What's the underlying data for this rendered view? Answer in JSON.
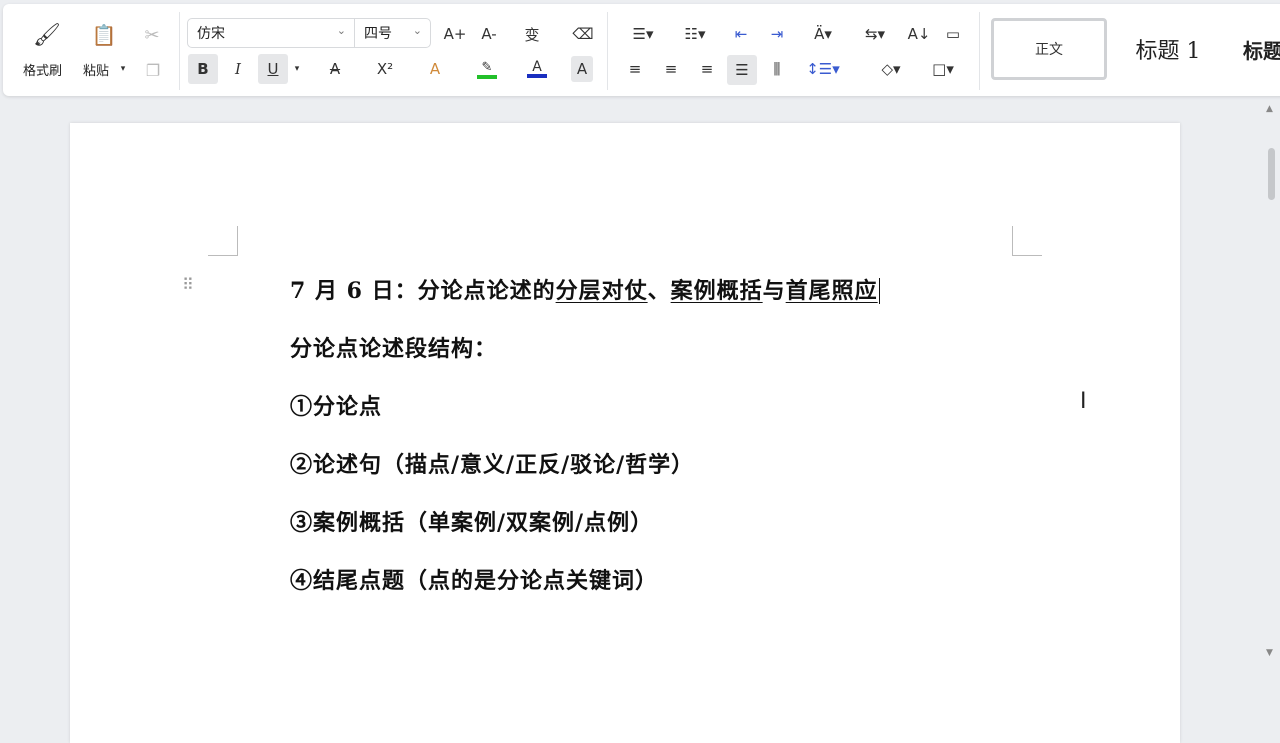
{
  "ribbon": {
    "clipboard": {
      "format_painter": "格式刷",
      "paste": "粘贴"
    },
    "font": {
      "family": "仿宋",
      "size": "四号",
      "grow": "A+",
      "shrink": "A-",
      "phonetic": "变",
      "bold": "B",
      "italic": "I",
      "underline": "U",
      "strike": "A",
      "superscript": "X²",
      "effects": "A",
      "highlight_color": "#22c02a",
      "font_color_label": "A",
      "font_color": "#1a2fc0",
      "shading": "A"
    },
    "styles": {
      "normal": "正文",
      "heading1": "标题 1",
      "heading2": "标题"
    }
  },
  "document": {
    "title_prefix": "7 月 6 日：分论点论述的",
    "title_u1": "分层对仗",
    "title_sep1": "、",
    "title_u2": "案例概括",
    "title_sep2": "与",
    "title_u3": "首尾照应",
    "lines": [
      "分论点论述段结构：",
      "①分论点",
      "②论述句（描点/意义/正反/驳论/哲学）",
      "③案例概括（单案例/双案例/点例）",
      "④结尾点题（点的是分论点关键词）"
    ]
  }
}
